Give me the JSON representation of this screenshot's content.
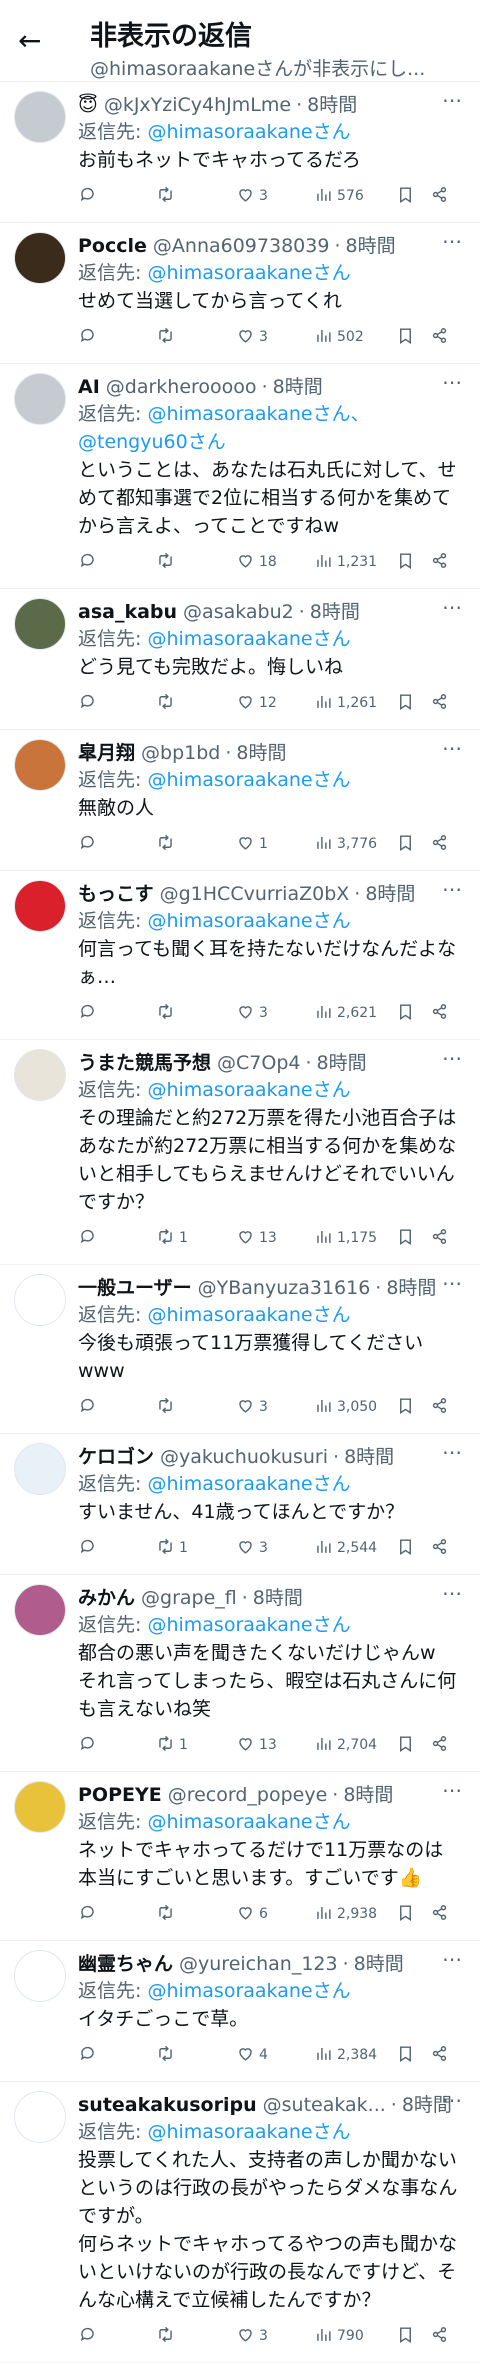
{
  "header": {
    "back_icon": "arrow-left-icon",
    "title": "非表示の返信",
    "subtitle": "@himasoraakaneさんが非表示にし..."
  },
  "replying_label": "返信先: ",
  "tweets": [
    {
      "name": "😇",
      "handle": "@kJxYziCy4hJmLme",
      "time": "8時間",
      "mentions": "@himasoraakaneさん",
      "text": "お前もネットでキャホってるだろ",
      "replies": "",
      "retweets": "",
      "likes": "3",
      "views": "576",
      "avatar_color": "#c5cbd1"
    },
    {
      "name": "Poccle",
      "handle": "@Anna609738039",
      "time": "8時間",
      "mentions": "@himasoraakaneさん",
      "text": "せめて当選してから言ってくれ",
      "replies": "",
      "retweets": "",
      "likes": "3",
      "views": "502",
      "avatar_color": "#3a2b1a"
    },
    {
      "name": "AI",
      "handle": "@darkherooooo",
      "time": "8時間",
      "mentions": "@himasoraakaneさん、\n@tengyu60さん",
      "text": "ということは、あなたは石丸氏に対して、せめて都知事選で2位に相当する何かを集めてから言えよ、ってことですねw",
      "replies": "",
      "retweets": "",
      "likes": "18",
      "views": "1,231",
      "avatar_color": "#c5cbd1"
    },
    {
      "name": "asa_kabu",
      "handle": "@asakabu2",
      "time": "8時間",
      "mentions": "@himasoraakaneさん",
      "text": "どう見ても完敗だよ。悔しいね",
      "replies": "",
      "retweets": "",
      "likes": "12",
      "views": "1,261",
      "avatar_color": "#5b6b4a"
    },
    {
      "name": "皐月翔",
      "handle": "@bp1bd",
      "time": "8時間",
      "mentions": "@himasoraakaneさん",
      "text": "無敵の人",
      "replies": "",
      "retweets": "",
      "likes": "1",
      "views": "3,776",
      "avatar_color": "#c9743a"
    },
    {
      "name": "もっこす",
      "handle": "@g1HCCvurriaZ0bX",
      "time": "8時間",
      "mentions": "@himasoraakaneさん",
      "text": "何言っても聞く耳を持たないだけなんだよなぁ…",
      "replies": "",
      "retweets": "",
      "likes": "3",
      "views": "2,621",
      "avatar_color": "#d9202b"
    },
    {
      "name": "うまた競馬予想",
      "handle": "@C7Op4",
      "time": "8時間",
      "mentions": "@himasoraakaneさん",
      "text": "その理論だと約272万票を得た小池百合子はあなたが約272万票に相当する何かを集めないと相手してもらえませんけどそれでいいんですか？",
      "replies": "",
      "retweets": "1",
      "likes": "13",
      "views": "1,175",
      "avatar_color": "#e8e4da"
    },
    {
      "name": "一般ユーザー",
      "handle": "@YBanyuza31616",
      "time": "8時間",
      "mentions": "@himasoraakaneさん",
      "text": "今後も頑張って11万票獲得してください\nwww",
      "replies": "",
      "retweets": "",
      "likes": "3",
      "views": "3,050",
      "avatar_color": "#ffffff"
    },
    {
      "name": "ケロゴン",
      "handle": "@yakuchuokusuri",
      "time": "8時間",
      "mentions": "@himasoraakaneさん",
      "text": "すいません、41歳ってほんとですか？",
      "replies": "",
      "retweets": "1",
      "likes": "3",
      "views": "2,544",
      "avatar_color": "#e9f1f8"
    },
    {
      "name": "みかん",
      "handle": "@grape_fl",
      "time": "8時間",
      "mentions": "@himasoraakaneさん",
      "text": "都合の悪い声を聞きたくないだけじゃんw\nそれ言ってしまったら、暇空は石丸さんに何も言えないね笑",
      "replies": "",
      "retweets": "1",
      "likes": "13",
      "views": "2,704",
      "avatar_color": "#b05c8c"
    },
    {
      "name": "POPEYE",
      "handle": "@record_popeye",
      "time": "8時間",
      "mentions": "@himasoraakaneさん",
      "text": "ネットでキャホってるだけで11万票なのは本当にすごいと思います。すごいです👍",
      "replies": "",
      "retweets": "",
      "likes": "6",
      "views": "2,938",
      "avatar_color": "#e8c23a"
    },
    {
      "name": "幽霊ちゃん",
      "handle": "@yureichan_123",
      "time": "8時間",
      "mentions": "@himasoraakaneさん",
      "text": "イタチごっこで草。",
      "replies": "",
      "retweets": "",
      "likes": "4",
      "views": "2,384",
      "avatar_color": "#ffffff"
    },
    {
      "name": "suteakakusoripu",
      "handle": "@suteakak...",
      "time": "8時間",
      "mentions": "@himasoraakaneさん",
      "text": "投票してくれた人、支持者の声しか聞かないというのは行政の長がやったらダメな事なんですが。\n何らネットでキャホってるやつの声も聞かないといけないのが行政の長なんですけど、そんな心構えで立候補したんですか？",
      "replies": "",
      "retweets": "",
      "likes": "3",
      "views": "790",
      "avatar_color": "#ffffff"
    }
  ],
  "icons": {
    "reply": "reply-icon",
    "retweet": "retweet-icon",
    "like": "heart-icon",
    "views": "views-icon",
    "bookmark": "bookmark-icon",
    "share": "share-icon",
    "more": "more-icon"
  },
  "colors": {
    "accent": "#1d9bf0",
    "secondary_text": "#536471"
  }
}
